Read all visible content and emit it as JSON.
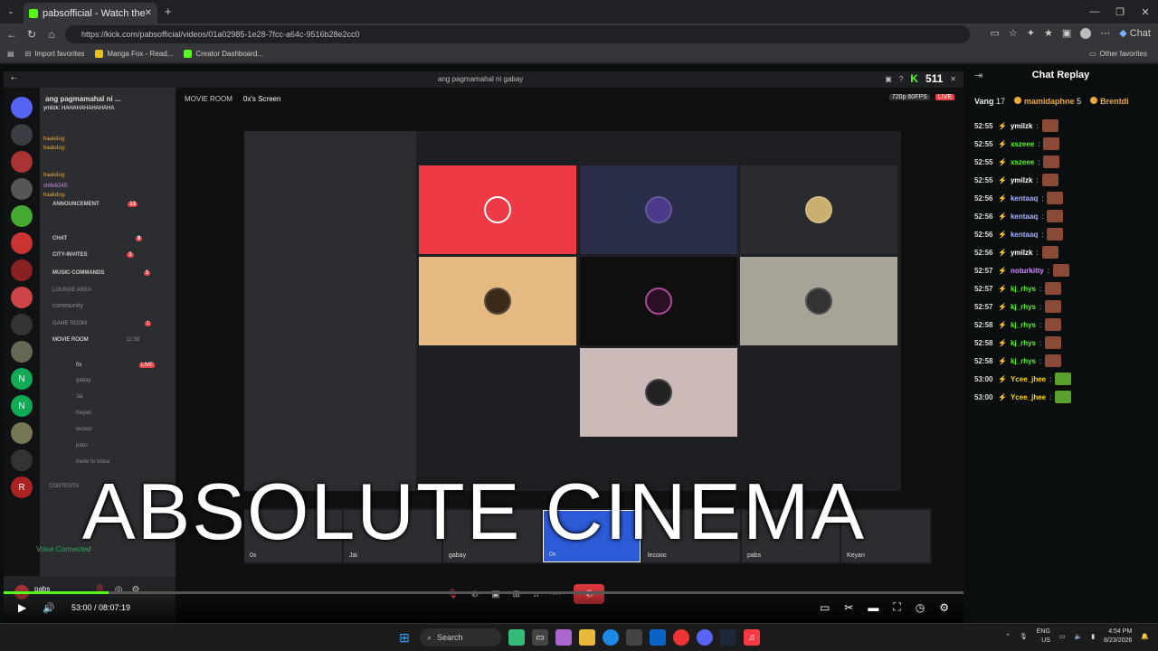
{
  "browser": {
    "tab_title": "pabsofficial - Watch the VOD on Ki",
    "url": "https://kick.com/pabsofficial/videos/01a02985-1e28-7fcc-a64c-9516b28e2cc0",
    "profile_label": "Chat",
    "bookmarks": [
      "Import favorites",
      "Manga Fox - Read...",
      "Creator Dashboard..."
    ],
    "other_favorites": "Other favorites"
  },
  "video": {
    "top_title": "ang pagmamahal ni gabay",
    "viewer_count": "511",
    "server_name": "ang pagmamahal ni ...",
    "room_label": "MOVIE ROOM",
    "screen_label": "0x's Screen",
    "quality_label": "720p 60FPS",
    "live_label": "LIVE",
    "channels": [
      {
        "label": "ANNOUNCEMENT",
        "badge": "13"
      },
      {
        "label": "CHAT",
        "badge": "9"
      },
      {
        "label": "CITY-INVITES",
        "badge": "1"
      },
      {
        "label": "MUSIC-COMMANDS",
        "badge": "1"
      },
      {
        "label": "LOUNGE AREA",
        "badge": ""
      },
      {
        "label": "community",
        "badge": ""
      },
      {
        "label": "GAME ROOM",
        "badge": "1"
      },
      {
        "label": "MOVIE ROOM",
        "badge": "12:58"
      }
    ],
    "voice_members": [
      "0x",
      "gabay",
      "Jai",
      "Keyan",
      "lecooo",
      "pabs"
    ],
    "invite_label": "Invite to Voice",
    "contents_label": "CONTENTS",
    "voice_connected": "Voice Connected",
    "user_name": "pabs",
    "overlay_chat": [
      "ymilzk: HAHAHAHAHAHAHA",
      "haakdog:",
      "haakdog:",
      "haakdog:",
      "chifeb245:",
      "haakdog:"
    ],
    "strip_names": [
      "0x",
      "Jai",
      "gabay",
      "0x",
      "lecooo",
      "pabs",
      "Keyan"
    ],
    "caption": "ABSOLUTE CINEMA",
    "current_time": "53:00",
    "duration": "08:07:19",
    "progress": 0.109
  },
  "chat": {
    "title": "Chat Replay",
    "gifters": [
      {
        "name": "Vang",
        "count": "17"
      },
      {
        "name": "mamidaphne",
        "count": "5"
      },
      {
        "name": "Brentdi",
        "count": ""
      }
    ],
    "messages": [
      {
        "time": "52:55",
        "user": "ymilzk",
        "color": "#ffffff"
      },
      {
        "time": "52:55",
        "user": "xszeee",
        "color": "#53fc18"
      },
      {
        "time": "52:55",
        "user": "xszeee",
        "color": "#53fc18"
      },
      {
        "time": "52:55",
        "user": "ymilzk",
        "color": "#ffffff"
      },
      {
        "time": "52:56",
        "user": "kentaaq",
        "color": "#a7b4ff"
      },
      {
        "time": "52:56",
        "user": "kentaaq",
        "color": "#a7b4ff"
      },
      {
        "time": "52:56",
        "user": "kentaaq",
        "color": "#a7b4ff"
      },
      {
        "time": "52:56",
        "user": "ymilzk",
        "color": "#ffffff"
      },
      {
        "time": "52:57",
        "user": "noturkitty",
        "color": "#d38cff"
      },
      {
        "time": "52:57",
        "user": "kj_rhys",
        "color": "#53fc18"
      },
      {
        "time": "52:57",
        "user": "kj_rhys",
        "color": "#53fc18"
      },
      {
        "time": "52:58",
        "user": "kj_rhys",
        "color": "#53fc18"
      },
      {
        "time": "52:58",
        "user": "kj_rhys",
        "color": "#53fc18"
      },
      {
        "time": "52:58",
        "user": "kj_rhys",
        "color": "#53fc18"
      },
      {
        "time": "53:00",
        "user": "Ycee_jhee",
        "color": "#ffd400"
      },
      {
        "time": "53:00",
        "user": "Ycee_jhee",
        "color": "#ffd400"
      }
    ]
  },
  "taskbar": {
    "search_label": "Search",
    "lang": "ENG",
    "region": "US",
    "time": "4:54 PM",
    "date": "8/23/2026"
  },
  "colors": {
    "kick_green": "#53fc18",
    "discord_red": "#da373c",
    "live_red": "#ed4245"
  }
}
